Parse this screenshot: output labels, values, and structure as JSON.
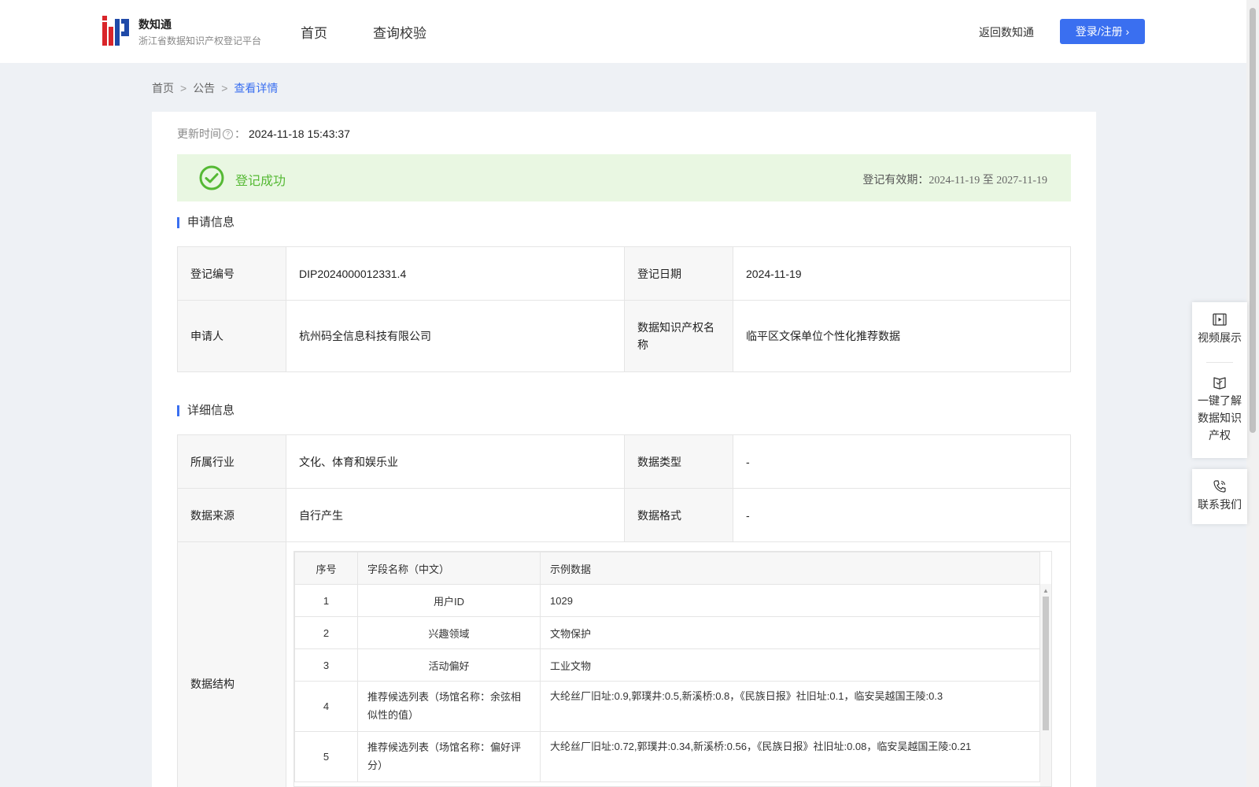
{
  "header": {
    "brand_name": "数知通",
    "brand_sub": "浙江省数据知识产权登记平台",
    "nav": [
      "首页",
      "查询校验"
    ],
    "back_link": "返回数知通",
    "login_button": "登录/注册 ›"
  },
  "breadcrumb": [
    "首页",
    "公告",
    "查看详情"
  ],
  "update": {
    "label": "更新时间",
    "colon": "：",
    "value": "2024-11-18 15:43:37"
  },
  "status": {
    "text": "登记成功",
    "validity_label": "登记有效期：",
    "validity_dates": "2024-11-19 至 2027-11-19"
  },
  "sections": {
    "apply": "申请信息",
    "detail": "详细信息"
  },
  "apply_info": {
    "reg_no_label": "登记编号",
    "reg_no": "DIP2024000012331.4",
    "reg_date_label": "登记日期",
    "reg_date": "2024-11-19",
    "applicant_label": "申请人",
    "applicant": "杭州码全信息科技有限公司",
    "ip_name_label": "数据知识产权名称",
    "ip_name": "临平区文保单位个性化推荐数据"
  },
  "detail_info": {
    "industry_label": "所属行业",
    "industry": "文化、体育和娱乐业",
    "data_type_label": "数据类型",
    "data_type": "-",
    "source_label": "数据来源",
    "source": "自行产生",
    "format_label": "数据格式",
    "format": "-",
    "structure_label": "数据结构"
  },
  "structure_table": {
    "headers": [
      "序号",
      "字段名称（中文）",
      "示例数据"
    ],
    "rows": [
      {
        "no": "1",
        "name": "用户ID",
        "example": "1029"
      },
      {
        "no": "2",
        "name": "兴趣领域",
        "example": "文物保护"
      },
      {
        "no": "3",
        "name": "活动偏好",
        "example": "工业文物"
      },
      {
        "no": "4",
        "name": "推荐候选列表（场馆名称：余弦相似性的值）",
        "example": "大纶丝厂旧址:0.9,郭璞井:0.5,新溪桥:0.8，《民族日报》社旧址:0.1，临安吴越国王陵:0.3"
      },
      {
        "no": "5",
        "name": "推荐候选列表（场馆名称：偏好评分）",
        "example": "大纶丝厂旧址:0.72,郭璞井:0.34,新溪桥:0.56，《民族日报》社旧址:0.08，临安吴越国王陵:0.21"
      }
    ]
  },
  "float_panel": {
    "video": "视频展示",
    "learn_line1": "一键了解",
    "learn_line2": "数据知识",
    "learn_line3": "产权",
    "contact": "联系我们"
  },
  "colors": {
    "primary": "#3a6ff0",
    "success": "#55b934",
    "success_bg": "#e9f7e2"
  }
}
